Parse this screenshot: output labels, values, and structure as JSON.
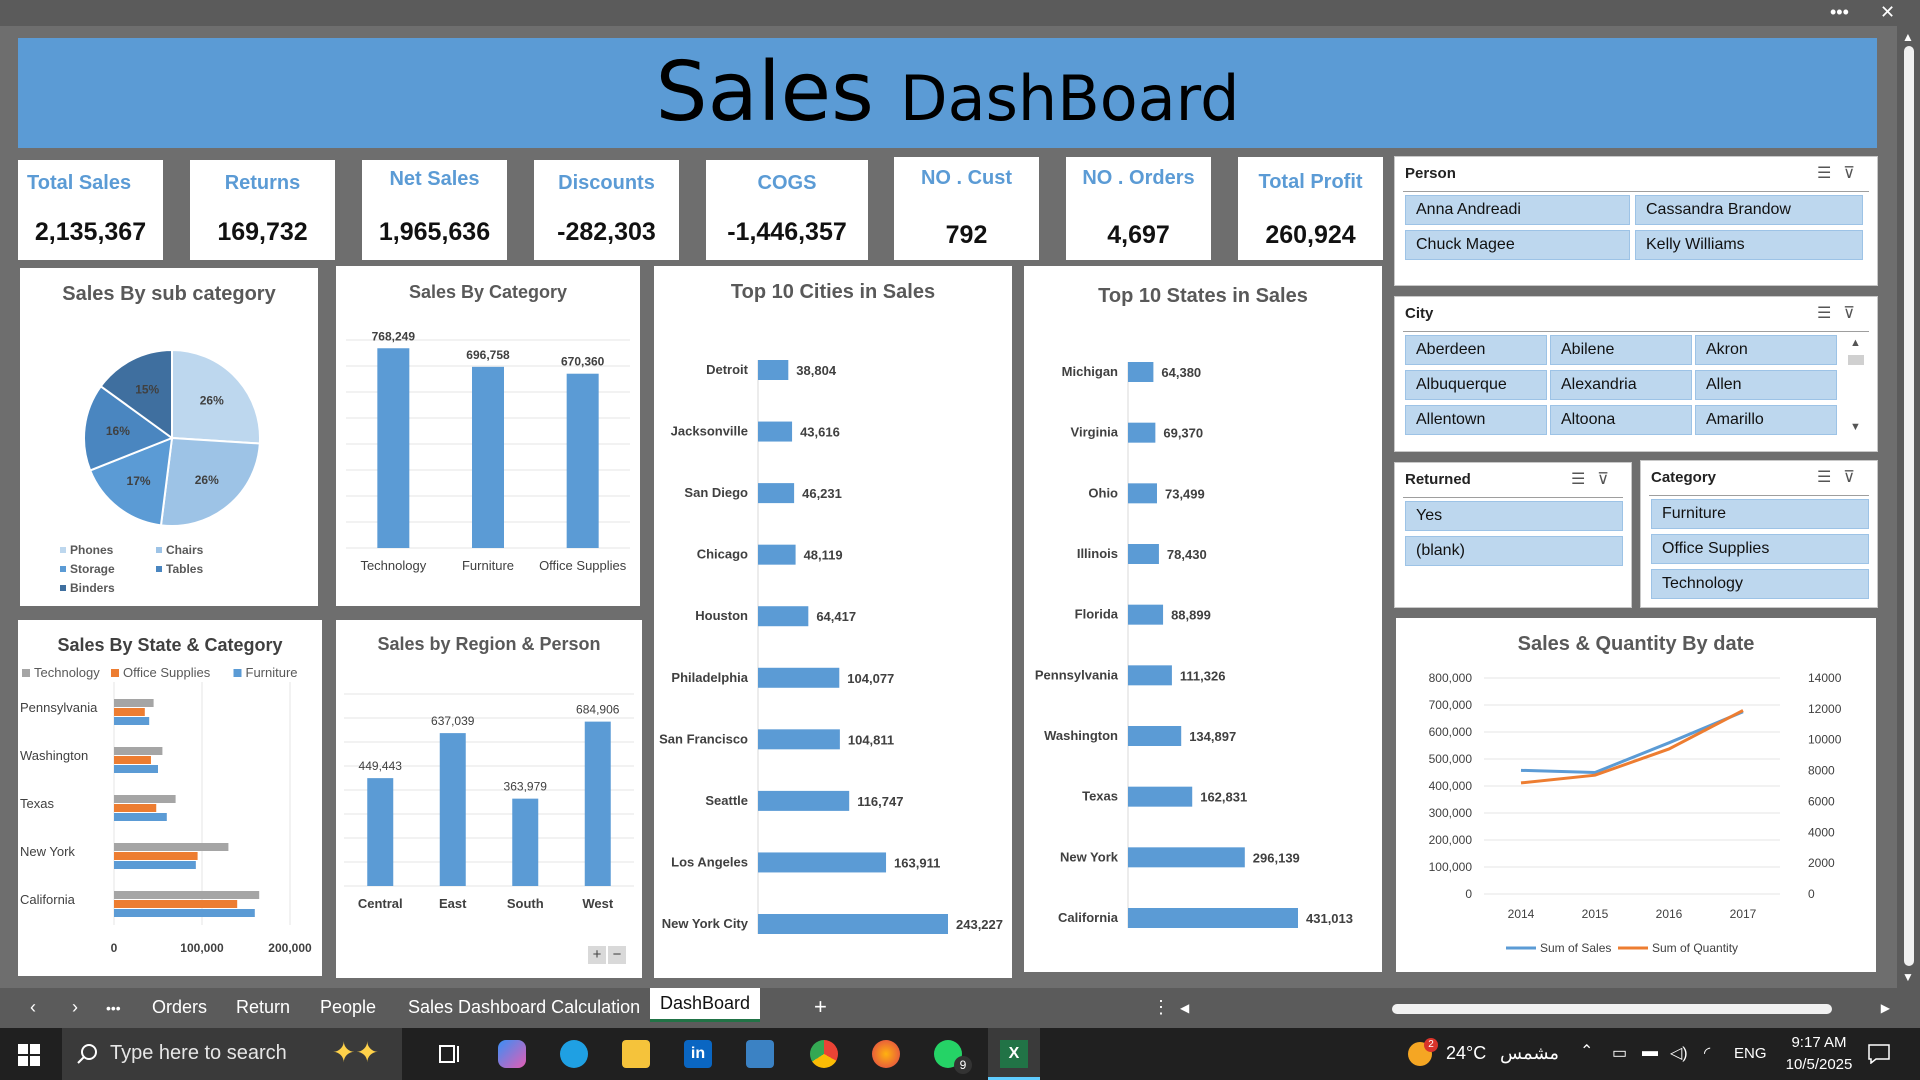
{
  "window": {
    "more": "•••",
    "close": "✕"
  },
  "banner": {
    "title_big": "Sales",
    "title_small": "DashBoard"
  },
  "kpis": [
    {
      "label": "Total Sales",
      "value": "2,135,367"
    },
    {
      "label": "Returns",
      "value": "169,732"
    },
    {
      "label": "Net Sales",
      "value": "1,965,636"
    },
    {
      "label": "Discounts",
      "value": "-282,303"
    },
    {
      "label": "COGS",
      "value": "-1,446,357"
    },
    {
      "label": "NO . Cust",
      "value": "792"
    },
    {
      "label": "NO . Orders",
      "value": "4,697"
    },
    {
      "label": "Total Profit",
      "value": "260,924"
    }
  ],
  "slicers": {
    "person": {
      "header": "Person",
      "items": [
        "Anna Andreadi",
        "Cassandra Brandow",
        "Chuck Magee",
        "Kelly Williams"
      ]
    },
    "city": {
      "header": "City",
      "items": [
        "Aberdeen",
        "Abilene",
        "Akron",
        "Albuquerque",
        "Alexandria",
        "Allen",
        "Allentown",
        "Altoona",
        "Amarillo"
      ]
    },
    "returned": {
      "header": "Returned",
      "items": [
        "Yes",
        "(blank)"
      ]
    },
    "category": {
      "header": "Category",
      "items": [
        "Furniture",
        "Office Supplies",
        "Technology"
      ]
    }
  },
  "colors": {
    "accent": "#5b9bd5",
    "orange": "#ed7d31",
    "gray": "#a5a5a5",
    "excel_green": "#217346"
  },
  "chart_data": [
    {
      "type": "pie",
      "title": "Sales By sub category",
      "categories": [
        "Phones",
        "Chairs",
        "Storage",
        "Tables",
        "Binders"
      ],
      "values": [
        26,
        26,
        17,
        16,
        15
      ],
      "labels": [
        "26%",
        "26%",
        "17%",
        "16%",
        "15%"
      ],
      "legend": "bottom",
      "colors": [
        "#bdd7ee",
        "#9dc3e6",
        "#5b9bd5",
        "#4a86c0",
        "#3f6f9f"
      ]
    },
    {
      "type": "bar",
      "title": "Sales By Category",
      "categories": [
        "Technology",
        "Furniture",
        "Office Supplies"
      ],
      "values": [
        768249,
        696758,
        670360
      ],
      "data_labels": [
        "768,249",
        "696,758",
        "670,360"
      ],
      "grid": true
    },
    {
      "type": "bar",
      "orientation": "horizontal",
      "title": "Top 10 Cities in Sales",
      "categories": [
        "Detroit",
        "Jacksonville",
        "San Diego",
        "Chicago",
        "Houston",
        "Philadelphia",
        "San Francisco",
        "Seattle",
        "Los Angeles",
        "New York City"
      ],
      "values": [
        38804,
        43616,
        46231,
        48119,
        64417,
        104077,
        104811,
        116747,
        163911,
        243227
      ],
      "data_labels": [
        "38,804",
        "43,616",
        "46,231",
        "48,119",
        "64,417",
        "104,077",
        "104,811",
        "116,747",
        "163,911",
        "243,227"
      ]
    },
    {
      "type": "bar",
      "orientation": "horizontal",
      "title": "Top 10 States in Sales",
      "categories": [
        "Michigan",
        "Virginia",
        "Ohio",
        "Illinois",
        "Florida",
        "Pennsylvania",
        "Washington",
        "Texas",
        "New York",
        "California"
      ],
      "values": [
        64380,
        69370,
        73499,
        78430,
        88899,
        111326,
        134897,
        162831,
        296139,
        431013
      ],
      "data_labels": [
        "64,380",
        "69,370",
        "73,499",
        "78,430",
        "88,899",
        "111,326",
        "134,897",
        "162,831",
        "296,139",
        "431,013"
      ]
    },
    {
      "type": "bar",
      "orientation": "horizontal",
      "title": "Sales By State & Category",
      "categories": [
        "Pennsylvania",
        "Washington",
        "Texas",
        "New York",
        "California"
      ],
      "series": [
        {
          "name": "Technology",
          "values": [
            45000,
            55000,
            70000,
            130000,
            165000
          ]
        },
        {
          "name": "Office Supplies",
          "values": [
            35000,
            42000,
            48000,
            95000,
            140000
          ]
        },
        {
          "name": "Furniture",
          "values": [
            40000,
            50000,
            60000,
            93000,
            160000
          ]
        }
      ],
      "xticks": [
        "0",
        "100,000",
        "200,000"
      ],
      "xlim": [
        0,
        200000
      ],
      "legend": "top-left"
    },
    {
      "type": "bar",
      "title": "Sales by Region & Person",
      "categories": [
        "Central",
        "East",
        "South",
        "West"
      ],
      "values": [
        449443,
        637039,
        363979,
        684906
      ],
      "data_labels": [
        "449,443",
        "637,039",
        "363,979",
        "684,906"
      ],
      "grid": true
    },
    {
      "type": "line",
      "title": "Sales & Quantity By date",
      "x": [
        "2014",
        "2015",
        "2016",
        "2017"
      ],
      "series": [
        {
          "name": "Sum of Sales",
          "values": [
            458000,
            450000,
            560000,
            675000
          ],
          "axis": "left"
        },
        {
          "name": "Sum of Quantity",
          "values": [
            7200,
            7700,
            9400,
            11900
          ],
          "axis": "right"
        }
      ],
      "yticks_left": [
        "0",
        "100,000",
        "200,000",
        "300,000",
        "400,000",
        "500,000",
        "600,000",
        "700,000",
        "800,000"
      ],
      "yticks_right": [
        "0",
        "2000",
        "4000",
        "6000",
        "8000",
        "10000",
        "12000",
        "14000"
      ],
      "ylim_left": [
        0,
        800000
      ],
      "ylim_right": [
        0,
        14000
      ],
      "legend": "bottom"
    }
  ],
  "zoom": {
    "plus": "+",
    "minus": "−"
  },
  "sheet_tabs": {
    "prev": "‹",
    "next": "›",
    "more": "•••",
    "tabs": [
      "Orders",
      "Return",
      "People",
      "Sales Dashboard Calculation",
      "DashBoard"
    ],
    "active": "DashBoard",
    "add": "+",
    "options": "⋮"
  },
  "taskbar": {
    "search_placeholder": "Type here to search",
    "whatsapp_badge": "9",
    "weather_badge": "2",
    "weather": "24°C",
    "weather_text": "مشمس",
    "lang": "ENG",
    "time": "9:17 AM",
    "date": "10/5/2025"
  }
}
